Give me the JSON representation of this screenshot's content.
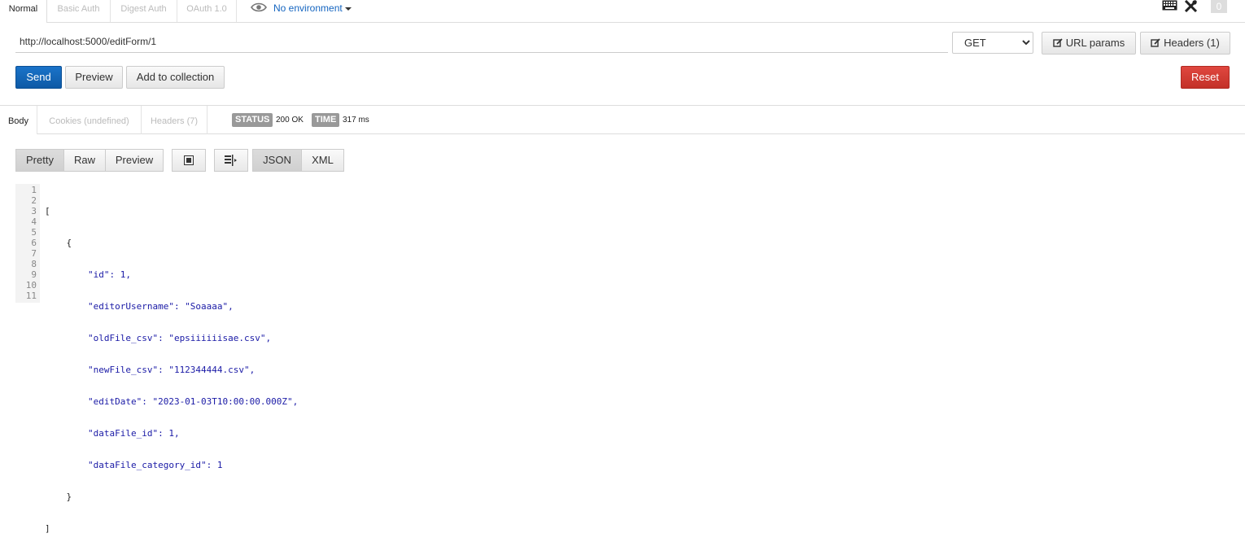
{
  "auth_tabs": [
    "Normal",
    "Basic Auth",
    "Digest Auth",
    "OAuth 1.0"
  ],
  "environment": {
    "label": "No environment",
    "icon": "eye-icon"
  },
  "top_icons": {
    "keyboard": "keyboard-icon",
    "tools": "tools-icon",
    "badge_count": "0"
  },
  "request": {
    "url": "http://localhost:5000/editForm/1",
    "method": "GET",
    "method_options": [
      "GET"
    ],
    "url_params_label": "URL params",
    "headers_label": "Headers (1)"
  },
  "actions": {
    "send": "Send",
    "preview": "Preview",
    "add_to_collection": "Add to collection",
    "reset": "Reset"
  },
  "response_tabs": [
    "Body",
    "Cookies (undefined)",
    "Headers (7)"
  ],
  "status": {
    "label": "STATUS",
    "value": "200 OK",
    "time_label": "TIME",
    "time_value": "317 ms"
  },
  "view_modes": [
    "Pretty",
    "Raw",
    "Preview"
  ],
  "format_modes": [
    "JSON",
    "XML"
  ],
  "response_body": {
    "line_numbers": [
      "1",
      "2",
      "3",
      "4",
      "5",
      "6",
      "7",
      "8",
      "9",
      "10",
      "11"
    ],
    "lines": [
      "[",
      "    {",
      "        \"id\": 1,",
      "        \"editorUsername\": \"Soaaaa\",",
      "        \"oldFile_csv\": \"epsiiiiiisae.csv\",",
      "        \"newFile_csv\": \"112344444.csv\",",
      "        \"editDate\": \"2023-01-03T10:00:00.000Z\",",
      "        \"dataFile_id\": 1,",
      "        \"dataFile_category_id\": 1",
      "    }",
      "]"
    ]
  },
  "colors": {
    "send": "#0e5aa6",
    "reset": "#c33128",
    "link": "#1565c0"
  }
}
